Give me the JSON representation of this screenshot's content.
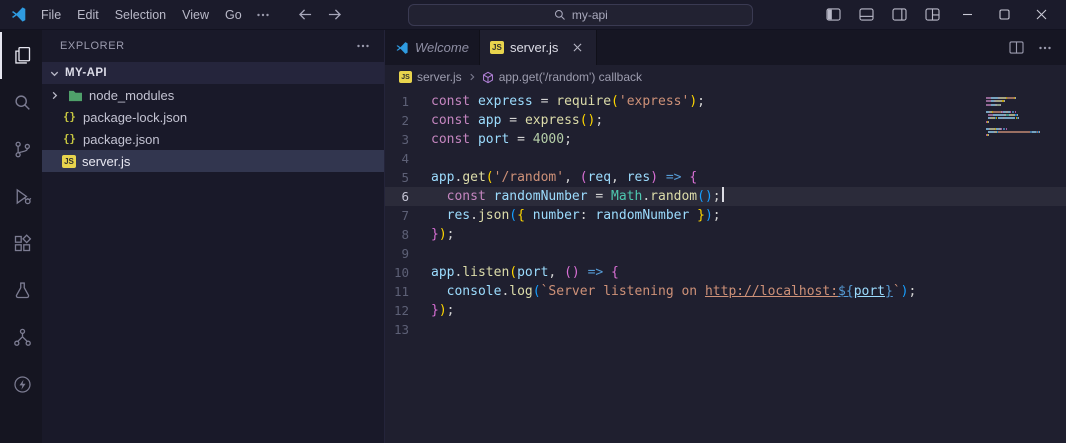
{
  "window": {
    "menus": [
      "File",
      "Edit",
      "Selection",
      "View",
      "Go"
    ],
    "search_value": "my-api"
  },
  "activity_bar": {
    "items": [
      {
        "icon": "files-icon",
        "active": true
      },
      {
        "icon": "search-icon"
      },
      {
        "icon": "source-control-icon"
      },
      {
        "icon": "run-debug-icon"
      },
      {
        "icon": "extensions-icon"
      },
      {
        "icon": "testing-beaker-icon"
      },
      {
        "icon": "type-hierarchy-icon"
      },
      {
        "icon": "thunder-client-icon"
      }
    ]
  },
  "explorer": {
    "header": "EXPLORER",
    "root": "MY-API",
    "files": [
      {
        "name": "node_modules",
        "type": "folder"
      },
      {
        "name": "package-lock.json",
        "type": "json"
      },
      {
        "name": "package.json",
        "type": "json"
      },
      {
        "name": "server.js",
        "type": "js",
        "selected": true
      }
    ]
  },
  "tabs": [
    {
      "label": "Welcome",
      "icon": "vscode-logo",
      "preview": true
    },
    {
      "label": "server.js",
      "icon": "js-file-icon",
      "active": true
    }
  ],
  "breadcrumb": {
    "file": "server.js",
    "symbol": "app.get('/random') callback"
  },
  "icons": {
    "js_label": "JS",
    "json_glyph": "{}"
  },
  "colors": {
    "accent": "#007acc",
    "js_badge": "#e8d44d",
    "folder": "#4fa06a",
    "json_icon": "#cbcb41",
    "tokens": {
      "kw": "#c586c0",
      "var": "#9cdcfe",
      "fn": "#dcdcaa",
      "str": "#ce9178",
      "num": "#b5cea8",
      "op": "#d4d4d4",
      "pl": "#d4d4d4",
      "cls": "#4ec9b0",
      "b1": "#ffd700",
      "b2": "#da70d6",
      "b3": "#179fff",
      "kw2": "#569cd6",
      "lnk": "#ce9178",
      "lnkb": "#569cd6",
      "lnkv": "#9cdcfe"
    }
  },
  "editor": {
    "lines": [
      {
        "n": 1,
        "tk": [
          [
            "const ",
            "kw"
          ],
          [
            "express ",
            "var"
          ],
          [
            "= ",
            "op"
          ],
          [
            "require",
            "fn"
          ],
          [
            "(",
            "b1"
          ],
          [
            "'express'",
            "str"
          ],
          [
            ")",
            "b1"
          ],
          [
            ";",
            "pl"
          ]
        ]
      },
      {
        "n": 2,
        "tk": [
          [
            "const ",
            "kw"
          ],
          [
            "app ",
            "var"
          ],
          [
            "= ",
            "op"
          ],
          [
            "express",
            "fn"
          ],
          [
            "()",
            "b1"
          ],
          [
            ";",
            "pl"
          ]
        ]
      },
      {
        "n": 3,
        "tk": [
          [
            "const ",
            "kw"
          ],
          [
            "port ",
            "var"
          ],
          [
            "= ",
            "op"
          ],
          [
            "4000",
            "num"
          ],
          [
            ";",
            "pl"
          ]
        ]
      },
      {
        "n": 4,
        "tk": []
      },
      {
        "n": 5,
        "tk": [
          [
            "app",
            "var"
          ],
          [
            ".",
            "pl"
          ],
          [
            "get",
            "fn"
          ],
          [
            "(",
            "b1"
          ],
          [
            "'/random'",
            "str"
          ],
          [
            ", ",
            "pl"
          ],
          [
            "(",
            "b2"
          ],
          [
            "req",
            "var"
          ],
          [
            ", ",
            "pl"
          ],
          [
            "res",
            "var"
          ],
          [
            ")",
            "b2"
          ],
          [
            " ",
            "pl"
          ],
          [
            "=>",
            "kw2"
          ],
          [
            " ",
            "pl"
          ],
          [
            "{",
            "b2"
          ]
        ]
      },
      {
        "n": 6,
        "active": true,
        "cursor": true,
        "tk": [
          [
            "  ",
            "pl"
          ],
          [
            "const ",
            "kw"
          ],
          [
            "randomNumber ",
            "var"
          ],
          [
            "= ",
            "op"
          ],
          [
            "Math",
            "cls"
          ],
          [
            ".",
            "pl"
          ],
          [
            "random",
            "fn"
          ],
          [
            "()",
            "b3"
          ],
          [
            ";",
            "pl"
          ]
        ]
      },
      {
        "n": 7,
        "tk": [
          [
            "  ",
            "pl"
          ],
          [
            "res",
            "var"
          ],
          [
            ".",
            "pl"
          ],
          [
            "json",
            "fn"
          ],
          [
            "(",
            "b3"
          ],
          [
            "{",
            "b1"
          ],
          [
            " ",
            "pl"
          ],
          [
            "number",
            "var"
          ],
          [
            ": ",
            "pl"
          ],
          [
            "randomNumber",
            "var"
          ],
          [
            " ",
            "pl"
          ],
          [
            "}",
            "b1"
          ],
          [
            ")",
            "b3"
          ],
          [
            ";",
            "pl"
          ]
        ]
      },
      {
        "n": 8,
        "tk": [
          [
            "}",
            "b2"
          ],
          [
            ")",
            "b1"
          ],
          [
            ";",
            "pl"
          ]
        ]
      },
      {
        "n": 9,
        "tk": []
      },
      {
        "n": 10,
        "tk": [
          [
            "app",
            "var"
          ],
          [
            ".",
            "pl"
          ],
          [
            "listen",
            "fn"
          ],
          [
            "(",
            "b1"
          ],
          [
            "port",
            "var"
          ],
          [
            ", ",
            "pl"
          ],
          [
            "()",
            "b2"
          ],
          [
            " ",
            "pl"
          ],
          [
            "=>",
            "kw2"
          ],
          [
            " ",
            "pl"
          ],
          [
            "{",
            "b2"
          ]
        ]
      },
      {
        "n": 11,
        "tk": [
          [
            "  ",
            "pl"
          ],
          [
            "console",
            "var"
          ],
          [
            ".",
            "pl"
          ],
          [
            "log",
            "fn"
          ],
          [
            "(",
            "b3"
          ],
          [
            "`Server listening on ",
            "str"
          ],
          [
            "http://localhost:",
            "lnk"
          ],
          [
            "${",
            "lnkb"
          ],
          [
            "port",
            "lnkv"
          ],
          [
            "}",
            "lnkb"
          ],
          [
            "`",
            "str"
          ],
          [
            ")",
            "b3"
          ],
          [
            ";",
            "pl"
          ]
        ]
      },
      {
        "n": 12,
        "tk": [
          [
            "}",
            "b2"
          ],
          [
            ")",
            "b1"
          ],
          [
            ";",
            "pl"
          ]
        ]
      },
      {
        "n": 13,
        "tk": []
      }
    ]
  }
}
